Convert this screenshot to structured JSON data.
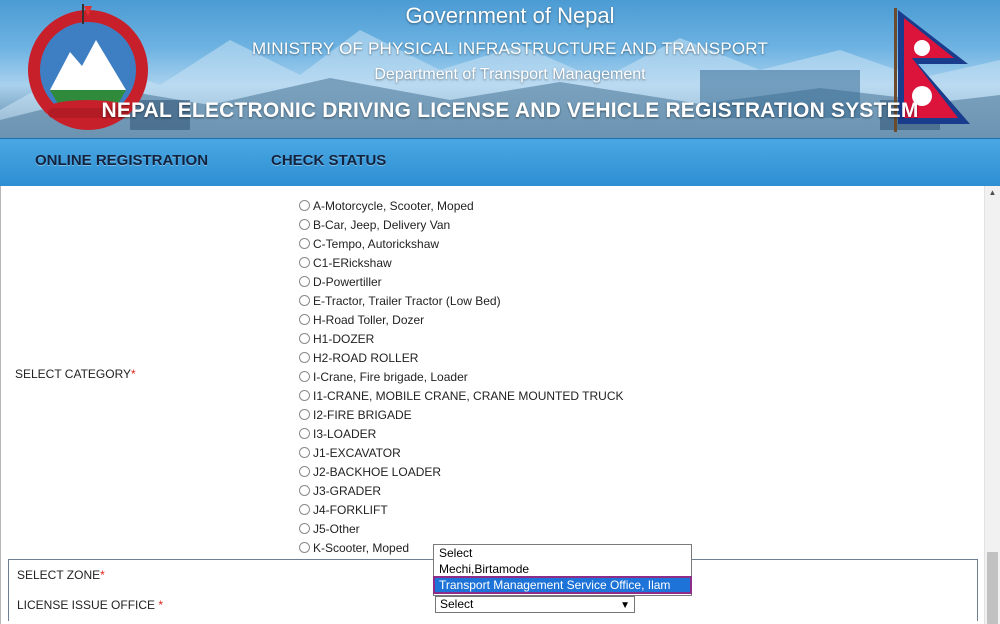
{
  "banner": {
    "title": "Government of Nepal",
    "ministry": "MINISTRY OF PHYSICAL INFRASTRUCTURE AND TRANSPORT",
    "department": "Department of Transport Management",
    "system": "NEPAL ELECTRONIC DRIVING LICENSE AND VEHICLE REGISTRATION SYSTEM"
  },
  "nav": {
    "online_registration": "ONLINE REGISTRATION",
    "check_status": "CHECK STATUS"
  },
  "form": {
    "category_label": "SELECT CATEGORY",
    "required_mark": "*",
    "categories": [
      "A-Motorcycle, Scooter, Moped",
      "B-Car, Jeep, Delivery Van",
      "C-Tempo, Autorickshaw",
      "C1-ERickshaw",
      "D-Powertiller",
      "E-Tractor, Trailer Tractor (Low Bed)",
      "H-Road Toller, Dozer",
      "H1-DOZER",
      "H2-ROAD ROLLER",
      "I-Crane, Fire brigade, Loader",
      "I1-CRANE, MOBILE CRANE, CRANE MOUNTED TRUCK",
      "I2-FIRE BRIGADE",
      "I3-LOADER",
      "J1-EXCAVATOR",
      "J2-BACKHOE LOADER",
      "J3-GRADER",
      "J4-FORKLIFT",
      "J5-Other",
      "K-Scooter, Moped"
    ],
    "zone_label": "SELECT ZONE",
    "office_label": "LICENSE ISSUE OFFICE ",
    "office_selected": "Select",
    "zone_dropdown_options": [
      "Select",
      "Mechi,Birtamode",
      "Transport Management Service Office, Ilam"
    ],
    "zone_dropdown_highlighted": "Transport Management Service Office, Ilam"
  },
  "colors": {
    "nav_bg": "#2d8fd2",
    "required": "#e2231a",
    "highlight": "#1e73d8",
    "highlight_outline": "#8e2c8a"
  }
}
